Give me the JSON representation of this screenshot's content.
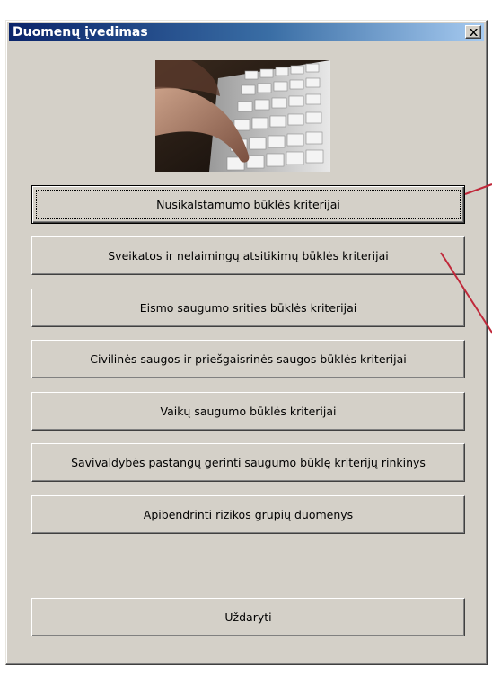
{
  "window": {
    "title": "Duomenų įvedimas",
    "close_icon": "close-x-icon"
  },
  "photo": {
    "subject": "hand-typing-on-keyboard-image"
  },
  "buttons": [
    {
      "label": "Nusikalstamumo būklės kriterijai"
    },
    {
      "label": "Sveikatos ir nelaimingų atsitikimų būklės kriterijai"
    },
    {
      "label": "Eismo saugumo srities būklės kriterijai"
    },
    {
      "label": "Civilinės saugos ir priešgaisrinės saugos būklės kriterijai"
    },
    {
      "label": "Vaikų saugumo būklės kriterijai"
    },
    {
      "label": "Savivaldybės pastangų gerinti saugumo būklę kriterijų rinkinys"
    },
    {
      "label": "Apibendrinti rizikos grupių duomenys"
    }
  ],
  "close_button": {
    "label": "Uždaryti"
  },
  "colors": {
    "titlebar_start": "#0a246a",
    "titlebar_end": "#a6caf0",
    "face": "#d4d0c8",
    "annotation_line": "#c0283a"
  }
}
